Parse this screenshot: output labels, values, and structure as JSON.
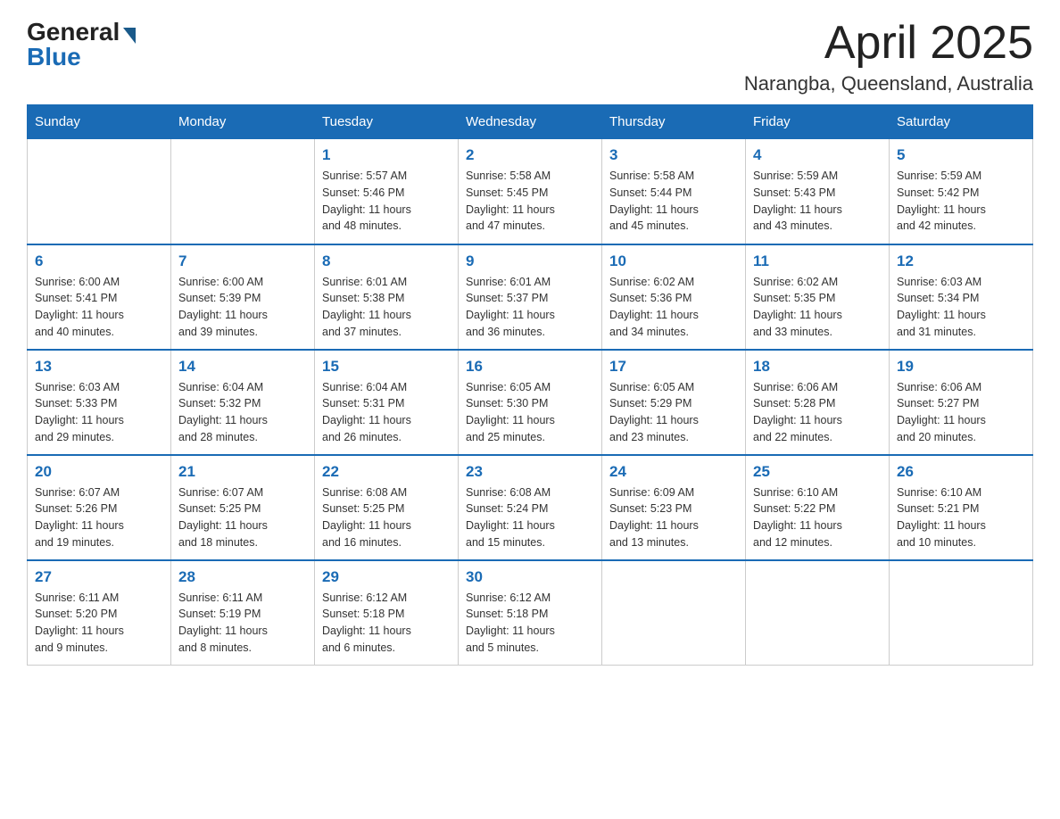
{
  "header": {
    "logo_general": "General",
    "logo_blue": "Blue",
    "month_title": "April 2025",
    "location": "Narangba, Queensland, Australia"
  },
  "columns": [
    "Sunday",
    "Monday",
    "Tuesday",
    "Wednesday",
    "Thursday",
    "Friday",
    "Saturday"
  ],
  "weeks": [
    [
      {
        "day": "",
        "info": ""
      },
      {
        "day": "",
        "info": ""
      },
      {
        "day": "1",
        "info": "Sunrise: 5:57 AM\nSunset: 5:46 PM\nDaylight: 11 hours\nand 48 minutes."
      },
      {
        "day": "2",
        "info": "Sunrise: 5:58 AM\nSunset: 5:45 PM\nDaylight: 11 hours\nand 47 minutes."
      },
      {
        "day": "3",
        "info": "Sunrise: 5:58 AM\nSunset: 5:44 PM\nDaylight: 11 hours\nand 45 minutes."
      },
      {
        "day": "4",
        "info": "Sunrise: 5:59 AM\nSunset: 5:43 PM\nDaylight: 11 hours\nand 43 minutes."
      },
      {
        "day": "5",
        "info": "Sunrise: 5:59 AM\nSunset: 5:42 PM\nDaylight: 11 hours\nand 42 minutes."
      }
    ],
    [
      {
        "day": "6",
        "info": "Sunrise: 6:00 AM\nSunset: 5:41 PM\nDaylight: 11 hours\nand 40 minutes."
      },
      {
        "day": "7",
        "info": "Sunrise: 6:00 AM\nSunset: 5:39 PM\nDaylight: 11 hours\nand 39 minutes."
      },
      {
        "day": "8",
        "info": "Sunrise: 6:01 AM\nSunset: 5:38 PM\nDaylight: 11 hours\nand 37 minutes."
      },
      {
        "day": "9",
        "info": "Sunrise: 6:01 AM\nSunset: 5:37 PM\nDaylight: 11 hours\nand 36 minutes."
      },
      {
        "day": "10",
        "info": "Sunrise: 6:02 AM\nSunset: 5:36 PM\nDaylight: 11 hours\nand 34 minutes."
      },
      {
        "day": "11",
        "info": "Sunrise: 6:02 AM\nSunset: 5:35 PM\nDaylight: 11 hours\nand 33 minutes."
      },
      {
        "day": "12",
        "info": "Sunrise: 6:03 AM\nSunset: 5:34 PM\nDaylight: 11 hours\nand 31 minutes."
      }
    ],
    [
      {
        "day": "13",
        "info": "Sunrise: 6:03 AM\nSunset: 5:33 PM\nDaylight: 11 hours\nand 29 minutes."
      },
      {
        "day": "14",
        "info": "Sunrise: 6:04 AM\nSunset: 5:32 PM\nDaylight: 11 hours\nand 28 minutes."
      },
      {
        "day": "15",
        "info": "Sunrise: 6:04 AM\nSunset: 5:31 PM\nDaylight: 11 hours\nand 26 minutes."
      },
      {
        "day": "16",
        "info": "Sunrise: 6:05 AM\nSunset: 5:30 PM\nDaylight: 11 hours\nand 25 minutes."
      },
      {
        "day": "17",
        "info": "Sunrise: 6:05 AM\nSunset: 5:29 PM\nDaylight: 11 hours\nand 23 minutes."
      },
      {
        "day": "18",
        "info": "Sunrise: 6:06 AM\nSunset: 5:28 PM\nDaylight: 11 hours\nand 22 minutes."
      },
      {
        "day": "19",
        "info": "Sunrise: 6:06 AM\nSunset: 5:27 PM\nDaylight: 11 hours\nand 20 minutes."
      }
    ],
    [
      {
        "day": "20",
        "info": "Sunrise: 6:07 AM\nSunset: 5:26 PM\nDaylight: 11 hours\nand 19 minutes."
      },
      {
        "day": "21",
        "info": "Sunrise: 6:07 AM\nSunset: 5:25 PM\nDaylight: 11 hours\nand 18 minutes."
      },
      {
        "day": "22",
        "info": "Sunrise: 6:08 AM\nSunset: 5:25 PM\nDaylight: 11 hours\nand 16 minutes."
      },
      {
        "day": "23",
        "info": "Sunrise: 6:08 AM\nSunset: 5:24 PM\nDaylight: 11 hours\nand 15 minutes."
      },
      {
        "day": "24",
        "info": "Sunrise: 6:09 AM\nSunset: 5:23 PM\nDaylight: 11 hours\nand 13 minutes."
      },
      {
        "day": "25",
        "info": "Sunrise: 6:10 AM\nSunset: 5:22 PM\nDaylight: 11 hours\nand 12 minutes."
      },
      {
        "day": "26",
        "info": "Sunrise: 6:10 AM\nSunset: 5:21 PM\nDaylight: 11 hours\nand 10 minutes."
      }
    ],
    [
      {
        "day": "27",
        "info": "Sunrise: 6:11 AM\nSunset: 5:20 PM\nDaylight: 11 hours\nand 9 minutes."
      },
      {
        "day": "28",
        "info": "Sunrise: 6:11 AM\nSunset: 5:19 PM\nDaylight: 11 hours\nand 8 minutes."
      },
      {
        "day": "29",
        "info": "Sunrise: 6:12 AM\nSunset: 5:18 PM\nDaylight: 11 hours\nand 6 minutes."
      },
      {
        "day": "30",
        "info": "Sunrise: 6:12 AM\nSunset: 5:18 PM\nDaylight: 11 hours\nand 5 minutes."
      },
      {
        "day": "",
        "info": ""
      },
      {
        "day": "",
        "info": ""
      },
      {
        "day": "",
        "info": ""
      }
    ]
  ]
}
